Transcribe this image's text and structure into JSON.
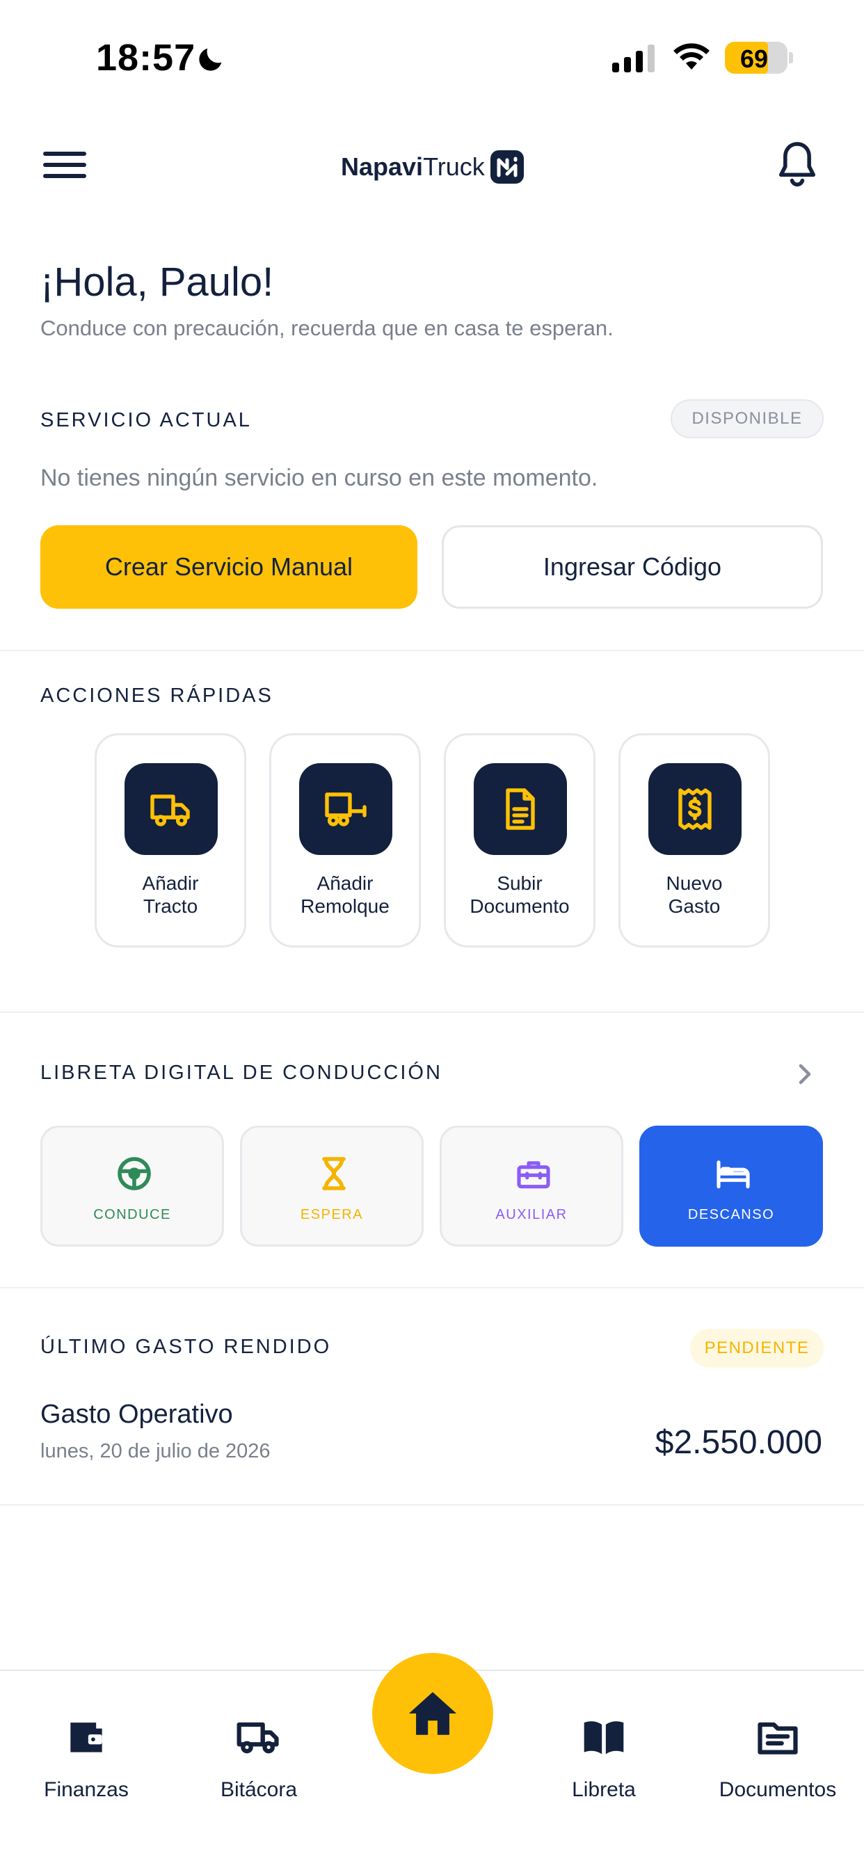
{
  "status_bar": {
    "time": "18:57",
    "battery_percent": "69",
    "battery_level": 0.69
  },
  "header": {
    "brand_bold": "Napavi",
    "brand_regular": "Truck"
  },
  "greeting": {
    "title": "¡Hola, Paulo!",
    "subtitle": "Conduce con precaución, recuerda que en casa te esperan."
  },
  "servicio_actual": {
    "title": "SERVICIO ACTUAL",
    "badge": "DISPONIBLE",
    "message": "No tienes ningún servicio en curso en este momento.",
    "primary_button": "Crear Servicio Manual",
    "secondary_button": "Ingresar Código"
  },
  "acciones_rapidas": {
    "title": "ACCIONES RÁPIDAS",
    "items": [
      {
        "line1": "Añadir",
        "line2": "Tracto",
        "icon": "truck-icon"
      },
      {
        "line1": "Añadir",
        "line2": "Remolque",
        "icon": "trailer-icon"
      },
      {
        "line1": "Subir",
        "line2": "Documento",
        "icon": "document-icon"
      },
      {
        "line1": "Nuevo",
        "line2": "Gasto",
        "icon": "receipt-icon"
      }
    ]
  },
  "libreta": {
    "title": "LIBRETA DIGITAL DE CONDUCCIÓN",
    "states": [
      {
        "label": "CONDUCE",
        "icon": "steering-wheel-icon",
        "color": "#2e8b57",
        "active": false
      },
      {
        "label": "ESPERA",
        "icon": "hourglass-icon",
        "color": "#f5b400",
        "active": false
      },
      {
        "label": "AUXILIAR",
        "icon": "toolbox-icon",
        "color": "#8b5cf6",
        "active": false
      },
      {
        "label": "DESCANSO",
        "icon": "bed-icon",
        "color": "#ffffff",
        "active": true
      }
    ]
  },
  "ultimo_gasto": {
    "title": "ÚLTIMO GASTO RENDIDO",
    "badge": "PENDIENTE",
    "name": "Gasto Operativo",
    "date": "lunes, 20 de julio de 2026",
    "amount": "$2.550.000"
  },
  "bottom_nav": {
    "items": [
      {
        "label": "Finanzas",
        "icon": "wallet-icon"
      },
      {
        "label": "Bitácora",
        "icon": "truck-icon"
      },
      {
        "label": "Libreta",
        "icon": "book-icon"
      },
      {
        "label": "Documentos",
        "icon": "documents-icon"
      }
    ],
    "home_icon": "home-icon"
  },
  "colors": {
    "primary_yellow": "#ffc107",
    "navy": "#14213d",
    "active_blue": "#2563eb"
  }
}
